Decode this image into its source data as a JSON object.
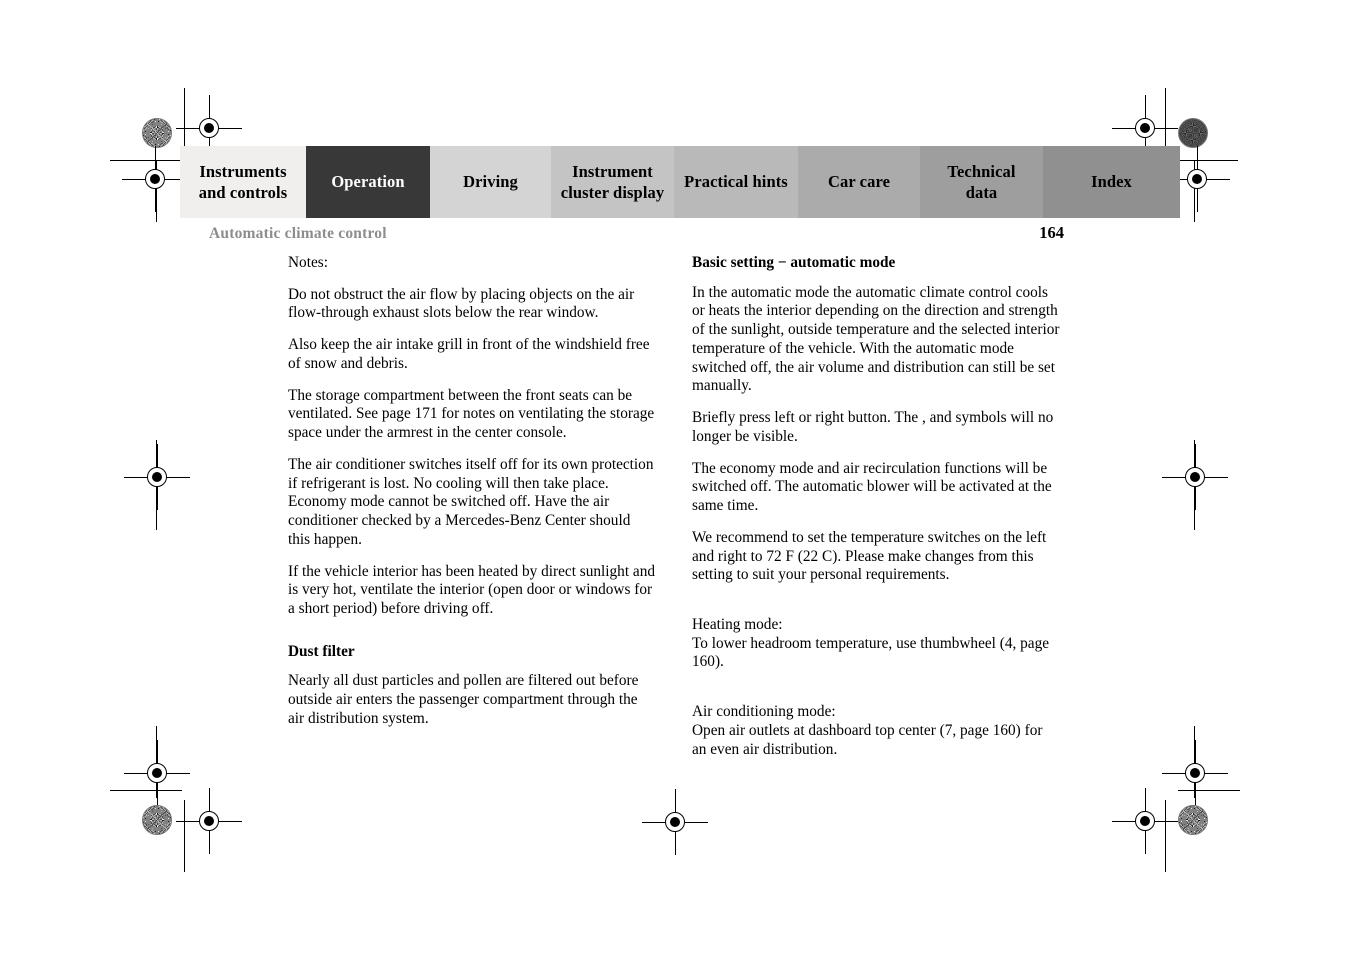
{
  "document": {
    "type": "owner-manual-page",
    "page_number": "164",
    "running_head": "Automatic climate control"
  },
  "tabs": [
    {
      "label": "Instruments\nand controls",
      "line1": "Instruments",
      "line2": "and controls",
      "color": "#f0efee",
      "text_color": "#000000",
      "active": false
    },
    {
      "label": "Operation",
      "line1": "Operation",
      "line2": "",
      "color": "#383838",
      "text_color": "#ffffff",
      "active": true
    },
    {
      "label": "Driving",
      "line1": "Driving",
      "line2": "",
      "color": "#d4d4d4",
      "text_color": "#000000",
      "active": false
    },
    {
      "label": "Instrument\ncluster display",
      "line1": "Instrument",
      "line2": "cluster display",
      "color": "#c4c4c4",
      "text_color": "#000000",
      "active": false
    },
    {
      "label": "Practical hints",
      "line1": "Practical hints",
      "line2": "",
      "color": "#b9b9b9",
      "text_color": "#000000",
      "active": false
    },
    {
      "label": "Car care",
      "line1": "Car care",
      "line2": "",
      "color": "#ababab",
      "text_color": "#000000",
      "active": false
    },
    {
      "label": "Technical\ndata",
      "line1": "Technical",
      "line2": "data",
      "color": "#9e9e9e",
      "text_color": "#000000",
      "active": false
    },
    {
      "label": "Index",
      "line1": "Index",
      "line2": "",
      "color": "#909090",
      "text_color": "#000000",
      "active": false
    }
  ],
  "left_column": {
    "notes_label": "Notes:",
    "paragraphs": [
      "Do not obstruct the air flow by placing objects on the air flow-through exhaust slots below the rear window.",
      "Also keep the air intake grill in front of the windshield free of snow and debris.",
      "The storage compartment between the front seats can be ventilated. See page 171 for notes on ventilating the storage space under the armrest in the center console.",
      "The air conditioner switches itself off for its own protection if refrigerant is lost. No cooling will then take place. Economy mode          cannot be switched off. Have the air conditioner checked by a Mercedes-Benz Center should this happen.",
      "If the vehicle interior has been heated by direct sunlight and is very hot, ventilate the interior (open door or windows for a short period) before driving off."
    ],
    "dust_filter_heading": "Dust filter",
    "dust_filter_text": "Nearly all dust particles and pollen are filtered out before outside air enters the passenger compartment through the air distribution system."
  },
  "right_column": {
    "heading": "Basic setting − automatic mode",
    "paragraphs": [
      "In the automatic mode the automatic climate control cools or heats the interior depending on the direction and strength of the sunlight, outside temperature and the selected interior temperature of the vehicle. With the automatic mode switched off, the air volume and distribution can still be set manually.",
      "Briefly press left or right           button. The              , and          symbols will no longer be visible.",
      "The economy mode and air recirculation functions will be switched off. The automatic blower will be activated at the same time.",
      "We recommend to set the temperature switches on the left and right to 72 F (22 C). Please make changes from this setting to suit your personal requirements."
    ],
    "heating_mode_label": "Heating mode:",
    "heating_mode_text": "To lower headroom temperature, use thumbwheel (4, page 160).",
    "ac_mode_label": "Air conditioning mode:",
    "ac_mode_text": "Open air outlets at dashboard top center (7, page 160) for an even air distribution."
  }
}
